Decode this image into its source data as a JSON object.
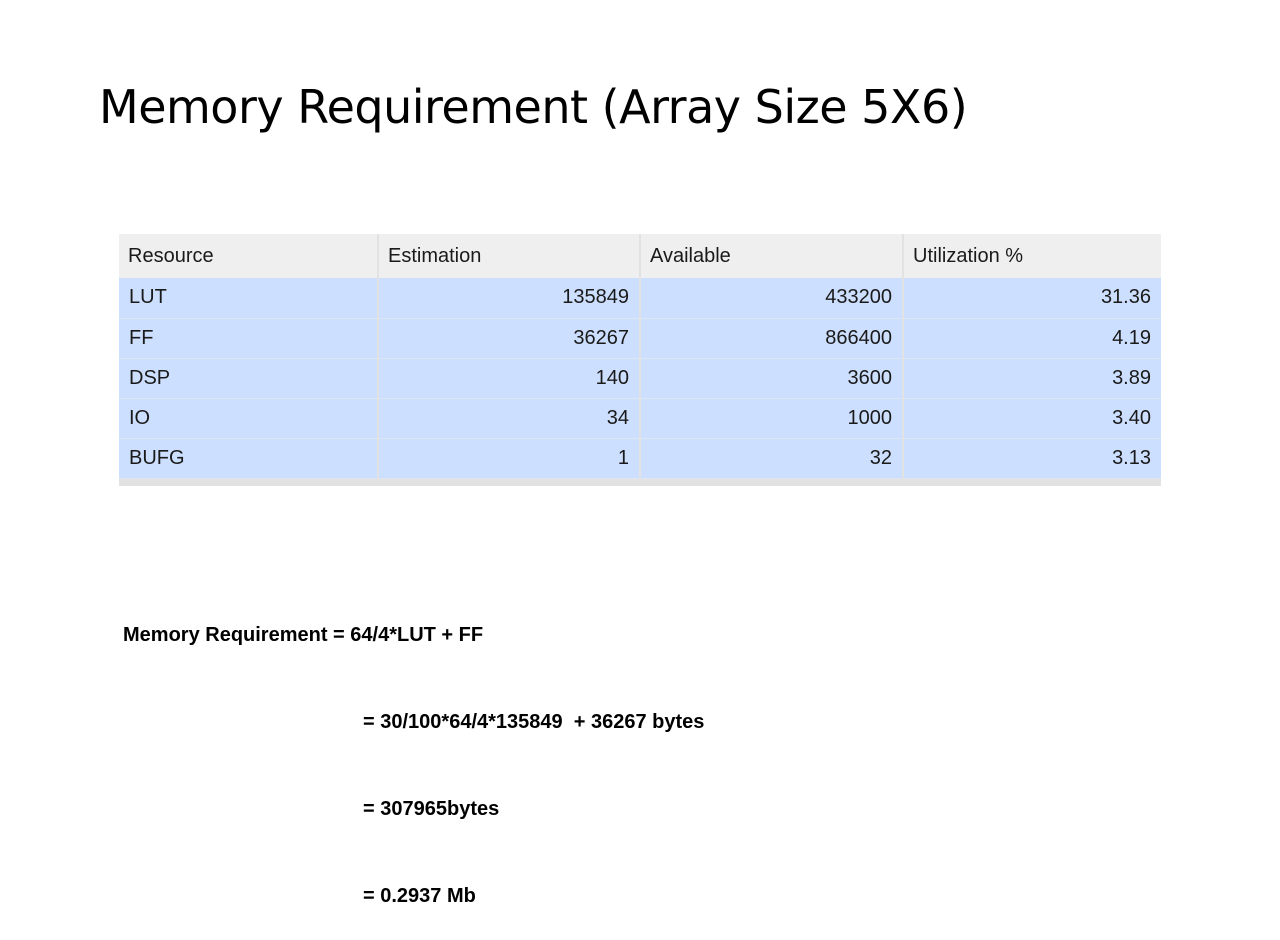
{
  "slide": {
    "title": "Memory Requirement (Array Size 5X6)"
  },
  "table": {
    "headers": [
      "Resource",
      "Estimation",
      "Available",
      "Utilization %"
    ],
    "rows": [
      {
        "resource": "LUT",
        "estimation": "135849",
        "available": "433200",
        "utilization": "31.36"
      },
      {
        "resource": "FF",
        "estimation": "36267",
        "available": "866400",
        "utilization": "4.19"
      },
      {
        "resource": "DSP",
        "estimation": "140",
        "available": "3600",
        "utilization": "3.89"
      },
      {
        "resource": "IO",
        "estimation": "34",
        "available": "1000",
        "utilization": "3.40"
      },
      {
        "resource": "BUFG",
        "estimation": "1",
        "available": "32",
        "utilization": "3.13"
      }
    ]
  },
  "formula": {
    "lines": [
      "Memory Requirement = 64/4*LUT + FF",
      "= 30/100*64/4*135849  + 36267 bytes",
      "= 307965bytes",
      "= 0.2937 Mb"
    ]
  },
  "colors": {
    "header_bg": "#efefef",
    "row_bg": "#cddfff",
    "grid": "#e2e2e2"
  }
}
